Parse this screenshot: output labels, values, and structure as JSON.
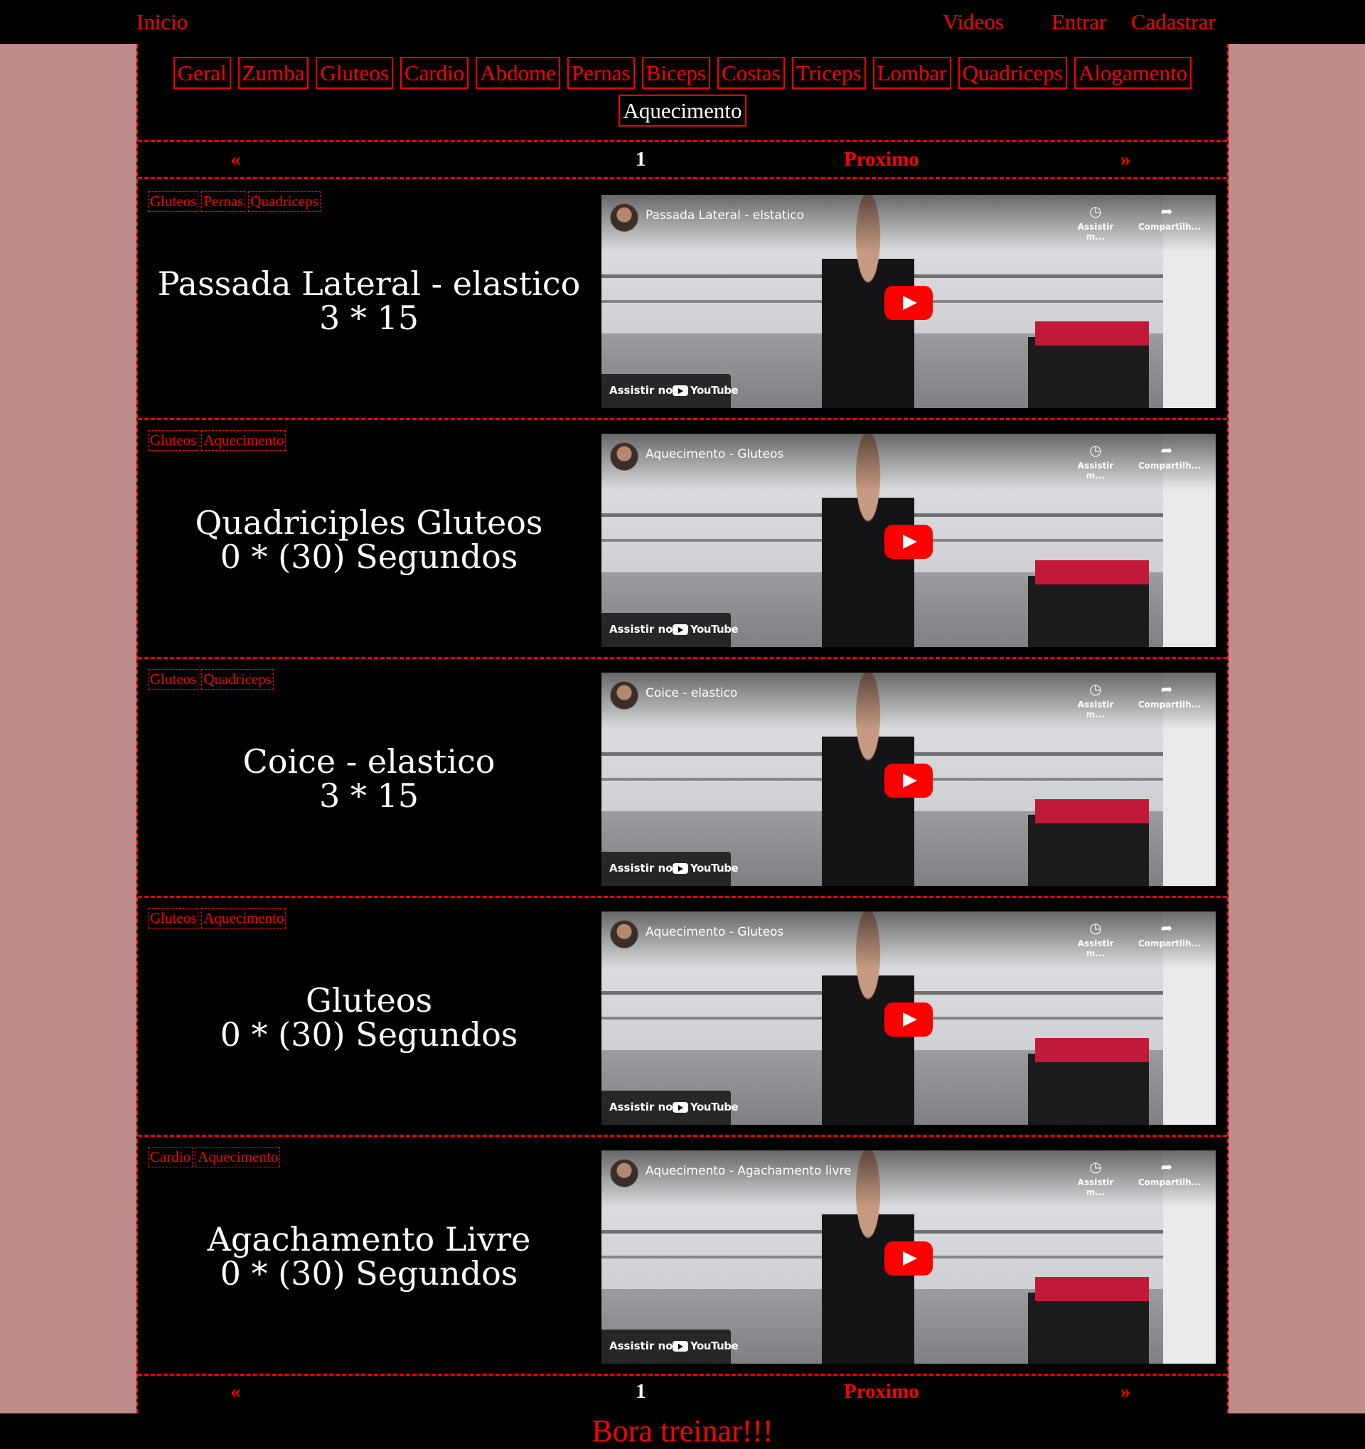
{
  "nav": {
    "home": "Inicio",
    "videos": "Videos",
    "login": "Entrar",
    "register": "Cadastrar"
  },
  "categories": [
    "Geral",
    "Zumba",
    "Gluteos",
    "Cardio",
    "Abdome",
    "Pernas",
    "Biceps",
    "Costas",
    "Triceps",
    "Lombar",
    "Quadriceps",
    "Alogamento",
    "Aquecimento"
  ],
  "active_category": "Aquecimento",
  "pagination": {
    "first": "«",
    "current": "1",
    "next": "Proximo",
    "last": "»"
  },
  "exercises": [
    {
      "tags": [
        "Gluteos",
        "Pernas",
        "Quadriceps"
      ],
      "name": "Passada Lateral - elastico",
      "reps": "3 * 15",
      "video": {
        "title": "Passada Lateral - elstatico",
        "watch_later": "Assistir m...",
        "share": "Compartilh...",
        "watch_on": "Assistir no",
        "brand": "YouTube"
      }
    },
    {
      "tags": [
        "Gluteos",
        "Aquecimento"
      ],
      "name": "Quadriciples Gluteos",
      "reps": "0 * (30) Segundos",
      "video": {
        "title": "Aquecimento - Gluteos",
        "watch_later": "Assistir m...",
        "share": "Compartilh...",
        "watch_on": "Assistir no",
        "brand": "YouTube"
      }
    },
    {
      "tags": [
        "Gluteos",
        "Quadriceps"
      ],
      "name": "Coice - elastico",
      "reps": "3 * 15",
      "video": {
        "title": "Coice - elastico",
        "watch_later": "Assistir m...",
        "share": "Compartilh...",
        "watch_on": "Assistir no",
        "brand": "YouTube"
      }
    },
    {
      "tags": [
        "Gluteos",
        "Aquecimento"
      ],
      "name": "Gluteos",
      "reps": "0 * (30) Segundos",
      "video": {
        "title": "Aquecimento - Gluteos",
        "watch_later": "Assistir m...",
        "share": "Compartilh...",
        "watch_on": "Assistir no",
        "brand": "YouTube"
      }
    },
    {
      "tags": [
        "Cardio",
        "Aquecimento"
      ],
      "name": "Agachamento Livre",
      "reps": "0 * (30) Segundos",
      "video": {
        "title": "Aquecimento - Agachamento livre",
        "watch_later": "Assistir m...",
        "share": "Compartilh...",
        "watch_on": "Assistir no",
        "brand": "YouTube"
      }
    }
  ],
  "footer": {
    "text": "Bora treinar!!!"
  },
  "colors": {
    "accent": "#ff0000",
    "background": "#bf8c8c",
    "panel": "#000000"
  }
}
